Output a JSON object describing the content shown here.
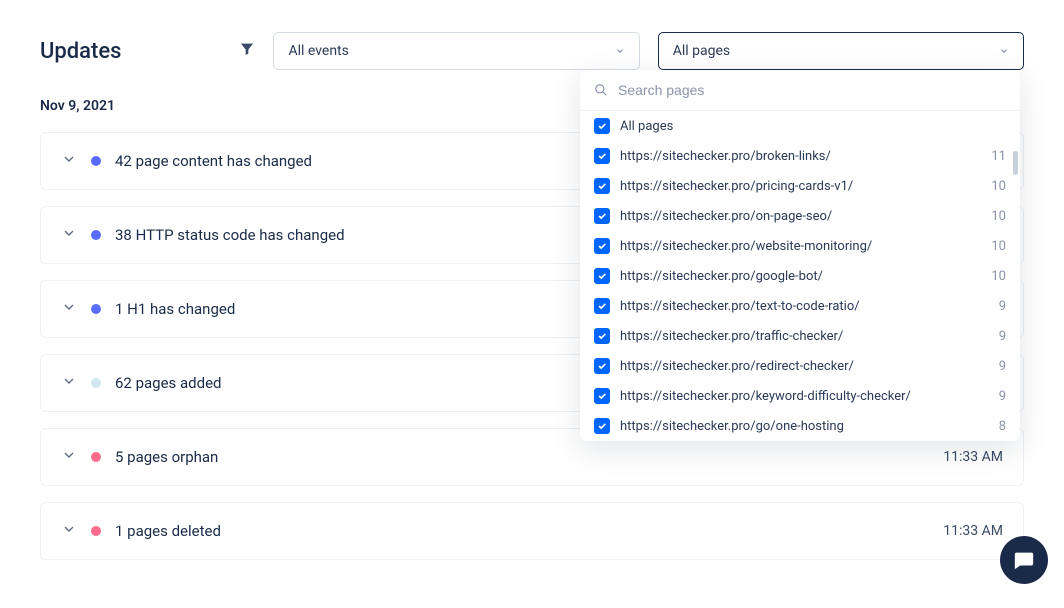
{
  "header": {
    "title": "Updates"
  },
  "filters": {
    "events_label": "All events",
    "pages_label": "All pages"
  },
  "date": "Nov 9, 2021",
  "events": [
    {
      "dot": "blue",
      "text": "42 page content has changed",
      "time": ""
    },
    {
      "dot": "blue",
      "text": "38 HTTP status code has changed",
      "time": ""
    },
    {
      "dot": "blue",
      "text": "1 H1 has changed",
      "time": ""
    },
    {
      "dot": "cyan",
      "text": "62 pages added",
      "time": ""
    },
    {
      "dot": "pink",
      "text": "5 pages orphan",
      "time": "11:33 AM"
    },
    {
      "dot": "pink",
      "text": "1 pages deleted",
      "time": "11:33 AM"
    }
  ],
  "pages_dropdown": {
    "search_placeholder": "Search pages",
    "options": [
      {
        "label": "All pages",
        "count": ""
      },
      {
        "label": "https://sitechecker.pro/broken-links/",
        "count": "11"
      },
      {
        "label": "https://sitechecker.pro/pricing-cards-v1/",
        "count": "10"
      },
      {
        "label": "https://sitechecker.pro/on-page-seo/",
        "count": "10"
      },
      {
        "label": "https://sitechecker.pro/website-monitoring/",
        "count": "10"
      },
      {
        "label": "https://sitechecker.pro/google-bot/",
        "count": "10"
      },
      {
        "label": "https://sitechecker.pro/text-to-code-ratio/",
        "count": "9"
      },
      {
        "label": "https://sitechecker.pro/traffic-checker/",
        "count": "9"
      },
      {
        "label": "https://sitechecker.pro/redirect-checker/",
        "count": "9"
      },
      {
        "label": "https://sitechecker.pro/keyword-difficulty-checker/",
        "count": "9"
      },
      {
        "label": "https://sitechecker.pro/go/one-hosting",
        "count": "8"
      }
    ]
  }
}
